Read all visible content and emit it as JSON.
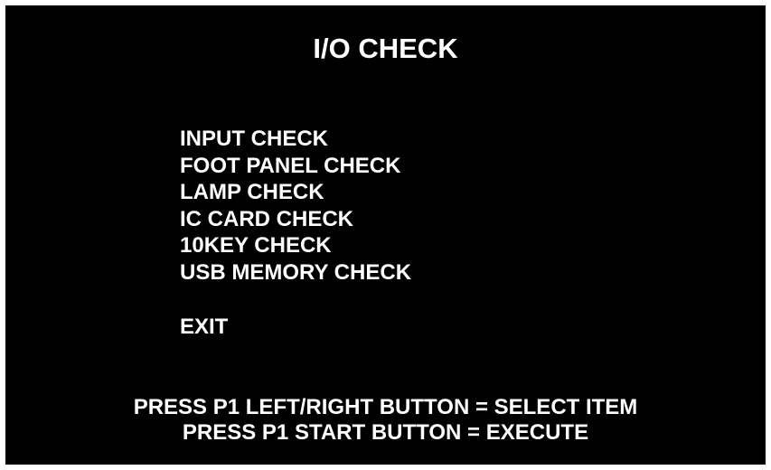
{
  "title": "I/O CHECK",
  "menu": {
    "items": [
      "INPUT CHECK",
      "FOOT PANEL CHECK",
      "LAMP CHECK",
      "IC CARD CHECK",
      "10KEY CHECK",
      "USB MEMORY CHECK"
    ],
    "exit": "EXIT"
  },
  "instructions": {
    "line1": "PRESS P1 LEFT/RIGHT BUTTON = SELECT ITEM",
    "line2": "PRESS P1 START BUTTON = EXECUTE"
  },
  "colors": {
    "background": "#000000",
    "text": "#ffffff",
    "border": "#ffffff"
  }
}
